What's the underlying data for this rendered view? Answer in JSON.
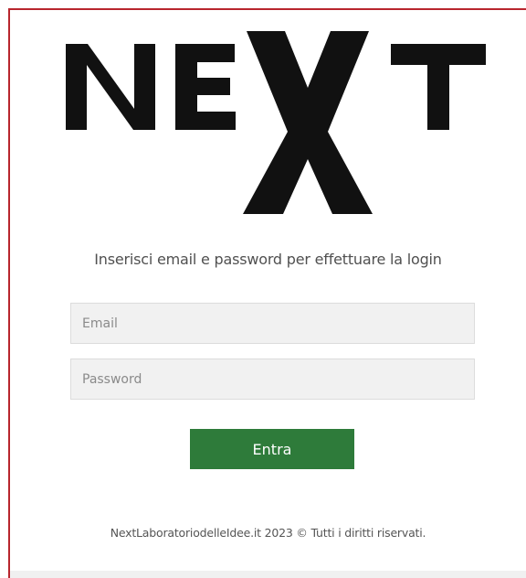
{
  "brand": {
    "logo_text": "NEXT",
    "accent_color": "#b8262e",
    "logo_color": "#111111"
  },
  "login": {
    "instruction": "Inserisci email e password per effettuare la login",
    "email_placeholder": "Email",
    "password_placeholder": "Password",
    "submit_label": "Entra",
    "submit_color": "#2e7b3a"
  },
  "footer": {
    "copyright": "NextLaboratoriodelleIdee.it 2023 © Tutti i diritti riservati."
  }
}
